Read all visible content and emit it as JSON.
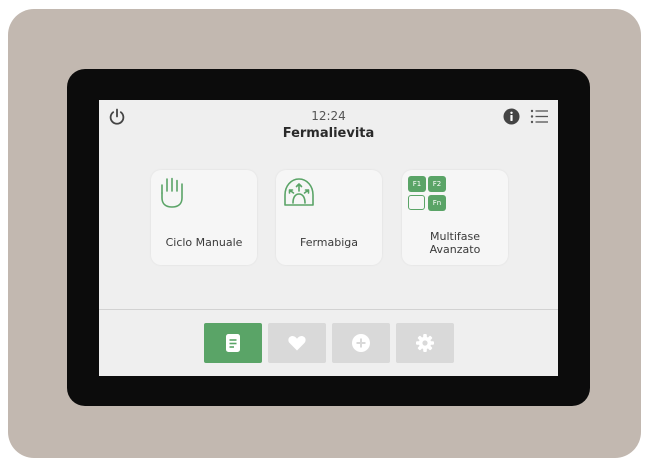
{
  "header": {
    "time": "12:24",
    "title": "Fermalievita",
    "power_icon": "power-icon",
    "info_icon": "info-icon",
    "menu_icon": "list-menu-icon"
  },
  "cards": [
    {
      "label": "Ciclo Manuale",
      "icon": "hand-icon"
    },
    {
      "label": "Fermabiga",
      "icon": "dome-arrows-icon"
    },
    {
      "label_line1": "Multifase",
      "label_line2": "Avanzato",
      "icon": "multiphase-icon",
      "badges": [
        "F1",
        "F2",
        "Fn"
      ]
    }
  ],
  "tabbar": [
    {
      "icon": "document-icon",
      "active": true
    },
    {
      "icon": "heart-icon",
      "active": false
    },
    {
      "icon": "plus-circle-icon",
      "active": false
    },
    {
      "icon": "gear-icon",
      "active": false
    }
  ],
  "colors": {
    "accent": "#5aa467",
    "screen_bg": "#efefef",
    "casing": "#c2b8b0",
    "bezel": "#0c0c0c"
  }
}
